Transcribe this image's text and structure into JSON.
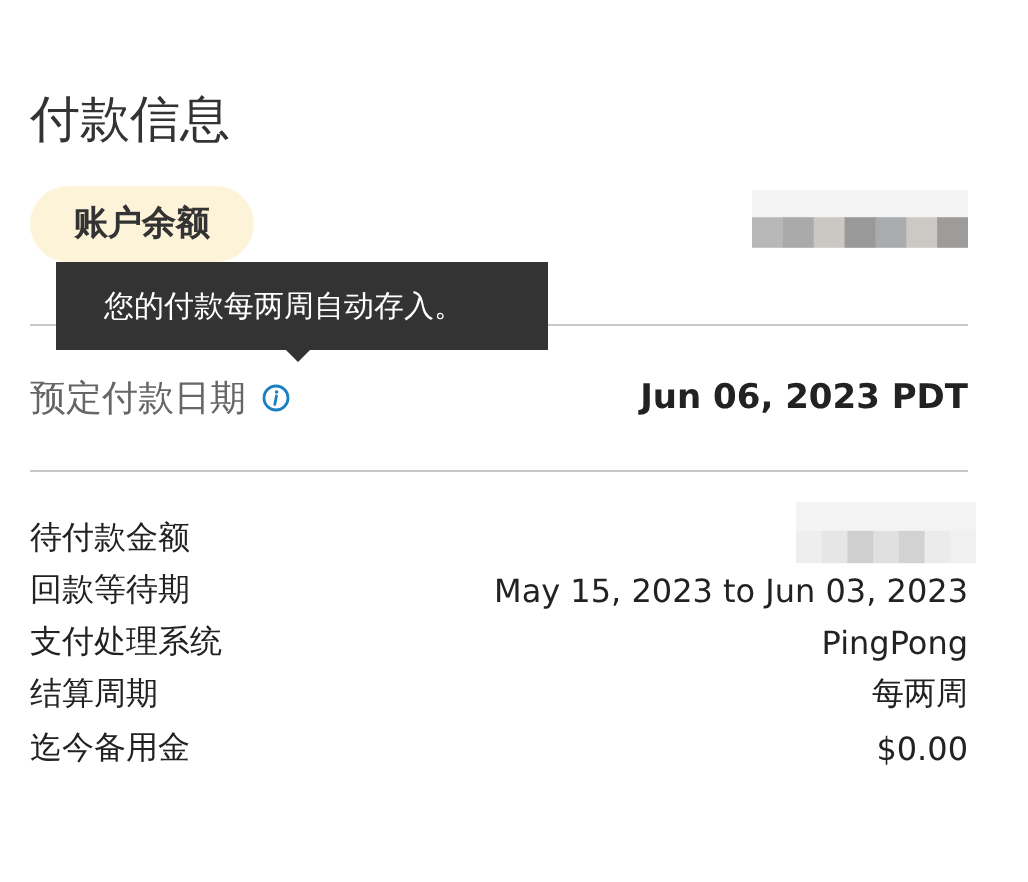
{
  "title": "付款信息",
  "balance": {
    "label": "账户余额",
    "kind": "redacted"
  },
  "tooltip": {
    "text": "您的付款每两周自动存入。"
  },
  "scheduled": {
    "label": "预定付款日期",
    "value": "Jun 06, 2023 PDT"
  },
  "rows": [
    {
      "label": "待付款金额",
      "kind": "redacted"
    },
    {
      "label": "回款等待期",
      "kind": "text",
      "value": "May 15, 2023 to Jun 03, 2023"
    },
    {
      "label": "支付处理系统",
      "kind": "text",
      "value": "PingPong"
    },
    {
      "label": "结算周期",
      "kind": "text",
      "value": "每两周"
    },
    {
      "label": "迄今备用金",
      "kind": "text",
      "value": "$0.00"
    }
  ]
}
